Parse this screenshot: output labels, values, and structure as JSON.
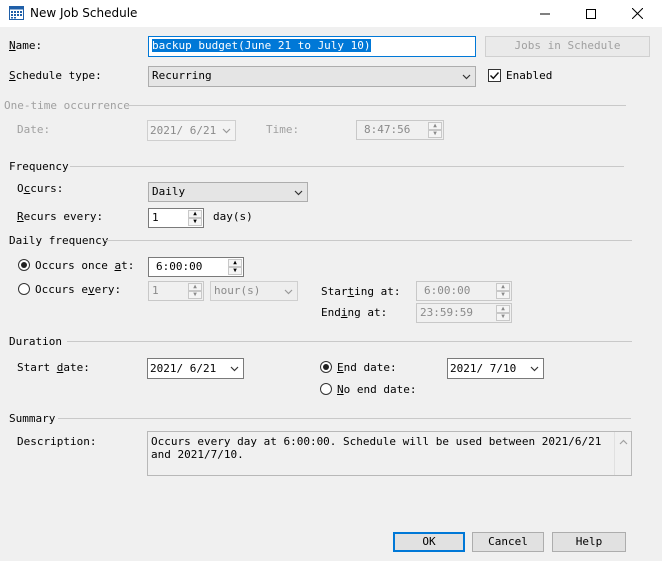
{
  "window": {
    "title": "New Job Schedule"
  },
  "name": {
    "label": "Name:",
    "value": "backup budget(June 21 to July 10)",
    "jobs_button": "Jobs in Schedule"
  },
  "schedule_type": {
    "label": "Schedule type:",
    "value": "Recurring",
    "enabled_label": "Enabled",
    "enabled_checked": true
  },
  "one_time": {
    "heading": "One-time occurrence",
    "date_label": "Date:",
    "date_value": "2021/ 6/21",
    "time_label": "Time:",
    "time_value": "8:47:56"
  },
  "frequency": {
    "heading": "Frequency",
    "occurs_label": "Occurs:",
    "occurs_value": "Daily",
    "recurs_label": "Recurs every:",
    "recurs_value": "1",
    "recurs_unit": "day(s)"
  },
  "daily_frequency": {
    "heading": "Daily frequency",
    "once_label": "Occurs once at:",
    "once_value": "6:00:00",
    "once_selected": true,
    "every_label": "Occurs every:",
    "every_value": "1",
    "every_unit": "hour(s)",
    "starting_label": "Starting at:",
    "starting_value": "6:00:00",
    "ending_label": "Ending at:",
    "ending_value": "23:59:59"
  },
  "duration": {
    "heading": "Duration",
    "start_label": "Start date:",
    "start_value": "2021/ 6/21",
    "end_label": "End date:",
    "end_value": "2021/ 7/10",
    "end_selected": true,
    "no_end_label": "No end date:"
  },
  "summary": {
    "heading": "Summary",
    "description_label": "Description:",
    "description_text": "Occurs every day at 6:00:00. Schedule will be used between 2021/6/21 and 2021/7/10."
  },
  "buttons": {
    "ok": "OK",
    "cancel": "Cancel",
    "help": "Help"
  },
  "colors": {
    "accent": "#0078d7",
    "dialog_bg": "#f0f0f0"
  }
}
